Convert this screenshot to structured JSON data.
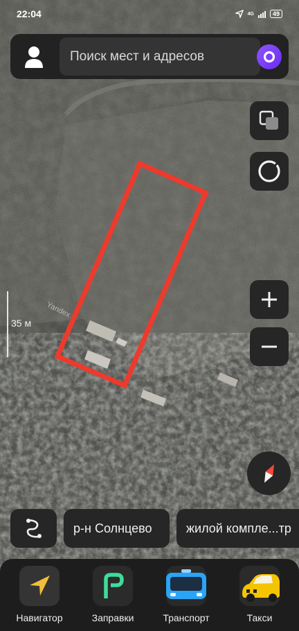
{
  "status": {
    "time": "22:04",
    "network": "4G",
    "battery": "49"
  },
  "search": {
    "placeholder": "Поиск мест и адресов"
  },
  "map": {
    "scale_label": "35 м",
    "watermark": "Yandex",
    "layers_icon": "layers-icon",
    "location_icon": "my-location-icon",
    "zoom_in_icon": "plus-icon",
    "zoom_out_icon": "minus-icon",
    "compass_icon": "compass-icon",
    "highlight_color": "#ee3a2c"
  },
  "chips": [
    {
      "icon": "route-icon"
    },
    {
      "label": "р-н Солнцево"
    },
    {
      "label": "жилой компле...тр"
    }
  ],
  "tabs": [
    {
      "label": "Навигатор",
      "icon": "navigator-icon",
      "color": "#f2bf3a"
    },
    {
      "label": "Заправки",
      "icon": "fuel-icon",
      "color": "#3edd9a"
    },
    {
      "label": "Транспорт",
      "icon": "bus-icon",
      "color": "#2aa4f4"
    },
    {
      "label": "Такси",
      "icon": "taxi-icon",
      "color": "#f5c400"
    }
  ]
}
